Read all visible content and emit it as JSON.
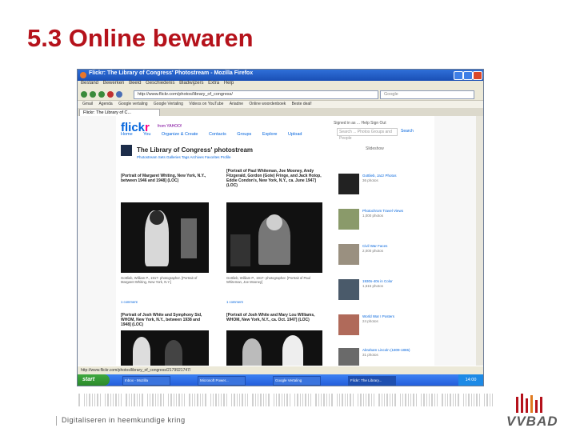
{
  "slide": {
    "title": "5.3 Online bewaren",
    "footer": "Digitaliseren in heemkundige kring",
    "logo": "VVBAD"
  },
  "browser": {
    "window_title": "Flickr: The Library of Congress' Photostream - Mozilla Firefox",
    "menu": [
      "Bestand",
      "Bewerken",
      "Beeld",
      "Geschiedenis",
      "Bladwijzers",
      "Extra",
      "Help"
    ],
    "url": "http://www.flickr.com/photos/library_of_congress/",
    "search_placeholder": "Google",
    "bookmarks": [
      "Gmail",
      "Agenda",
      "Google vertaling",
      "Google Vertaling",
      "Videos on YouTube",
      "Ariadne",
      "Online woordenboek",
      "Beste deal!"
    ],
    "tab_label": "Flickr: The Library of C...",
    "status": "http://www.flickr.com/photos/library_of_congress/2179921747/",
    "taskbar_start": "start",
    "taskbar_items": [
      "Inbox - Mozilla",
      "Microsoft Power...",
      "Google Vertaling",
      "Flickr: The Library..."
    ],
    "clock": "14:00"
  },
  "flickr": {
    "logo_a": "flick",
    "logo_b": "r",
    "yahoo": "from YAHOO!",
    "signed_in": "Signed in as ... Help Sign Out",
    "search_placeholder": "Search ... Photos Groups and People",
    "search_button": "Search",
    "nav": [
      "Home",
      "You",
      "Organize & Create",
      "Contacts",
      "Groups",
      "Explore",
      "Upload"
    ],
    "stream_title": "The Library of Congress' photostream",
    "stream_sub": "Photostream  Sets  Galleries  Tags  Archives  Favorites  Profile",
    "slideshow": "Slideshow",
    "photos": [
      {
        "caption": "[Portrait of Margaret Whiting, New York, N.Y., between 1946 and 1948] (LOC)",
        "meta": "Gottlieb, William P., 1917- photographer. [Portrait of Margaret Whiting, New York, N.Y.]",
        "stats": "1 comment"
      },
      {
        "caption": "[Portrait of Paul Whiteman, Joe Mooney, Andy Fitzgerald, Gordon (Gote) Fringe, and Jack Hotop, Eddie Condon's, New York, N.Y., ca. June 1947] (LOC)",
        "meta": "Gottlieb, William P., 1917- photographer. [Portrait of Paul Whiteman, Joe Mooney]",
        "stats": "1 comment"
      },
      {
        "caption": "[Portrait of Josh White and Symphony Sid, WHOM, New York, N.Y., between 1938 and 1948] (LOC)",
        "meta": "",
        "stats": ""
      },
      {
        "caption": "[Portrait of Josh White and Mary Lou Williams, WHOM, New York, N.Y., ca. Oct. 1947] (LOC)",
        "meta": "",
        "stats": ""
      }
    ],
    "sets": [
      {
        "name": "Gottlieb, Jazz Photos",
        "info": "36 photos"
      },
      {
        "name": "Photochrom Travel Views",
        "info": "1,000 photos"
      },
      {
        "name": "Civil War Faces",
        "info": "2,000 photos"
      },
      {
        "name": "1930s-40s in Color",
        "info": "1,615 photos"
      },
      {
        "name": "World War I Posters",
        "info": "24 photos"
      },
      {
        "name": "Abraham Lincoln (1809-1865)",
        "info": "31 photos"
      }
    ]
  },
  "colors": {
    "title_red": "#b5121b",
    "flickr_blue": "#0063dc",
    "flickr_pink": "#ff0084"
  }
}
